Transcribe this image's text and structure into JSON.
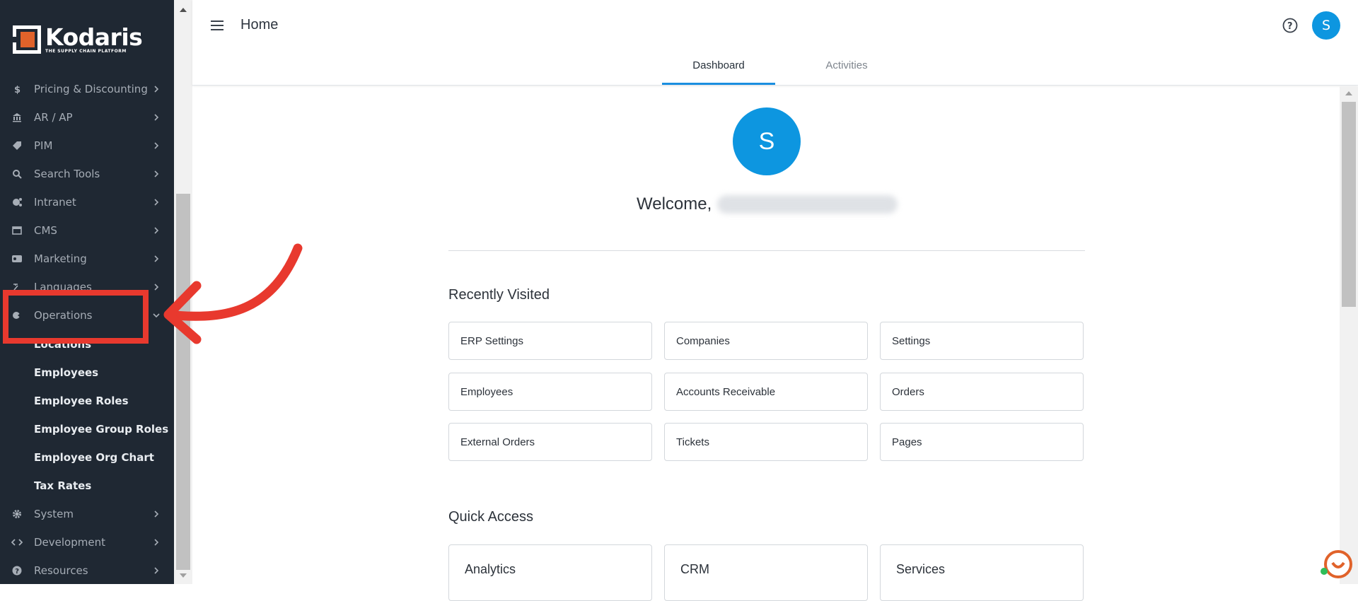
{
  "brand": {
    "name": "Kodaris",
    "tagline": "THE SUPPLY CHAIN PLATFORM"
  },
  "sidebar": {
    "items": [
      {
        "label": "Pricing & Discounting",
        "icon": "dollar-icon"
      },
      {
        "label": "AR / AP",
        "icon": "bank-icon"
      },
      {
        "label": "PIM",
        "icon": "tag-icon"
      },
      {
        "label": "Search Tools",
        "icon": "search-icon"
      },
      {
        "label": "Intranet",
        "icon": "network-icon"
      },
      {
        "label": "CMS",
        "icon": "cms-icon"
      },
      {
        "label": "Marketing",
        "icon": "marketing-icon"
      },
      {
        "label": "Languages",
        "icon": "translate-icon"
      },
      {
        "label": "Operations",
        "icon": "operations-icon"
      }
    ],
    "operations_sub": [
      "Locations",
      "Employees",
      "Employee Roles",
      "Employee Group Roles",
      "Employee Org Chart",
      "Tax Rates"
    ],
    "bottom_items": [
      {
        "label": "System",
        "icon": "gear-icon"
      },
      {
        "label": "Development",
        "icon": "code-icon"
      },
      {
        "label": "Resources",
        "icon": "help-circle-icon"
      }
    ]
  },
  "header": {
    "title": "Home",
    "avatar_initial": "S",
    "tabs": [
      "Dashboard",
      "Activities"
    ],
    "active_tab": "Dashboard"
  },
  "main": {
    "avatar_initial": "S",
    "welcome": "Welcome,",
    "recently_visited_title": "Recently Visited",
    "recent": [
      "ERP Settings",
      "Companies",
      "Settings",
      "Employees",
      "Accounts Receivable",
      "Orders",
      "External Orders",
      "Tickets",
      "Pages"
    ],
    "quick_access_title": "Quick Access",
    "quick": [
      "Analytics",
      "CRM",
      "Services"
    ]
  },
  "colors": {
    "sidebar_bg": "#1f2833",
    "accent": "#0d96e0",
    "highlight": "#e8392e",
    "brand_orange": "#e0622a"
  }
}
